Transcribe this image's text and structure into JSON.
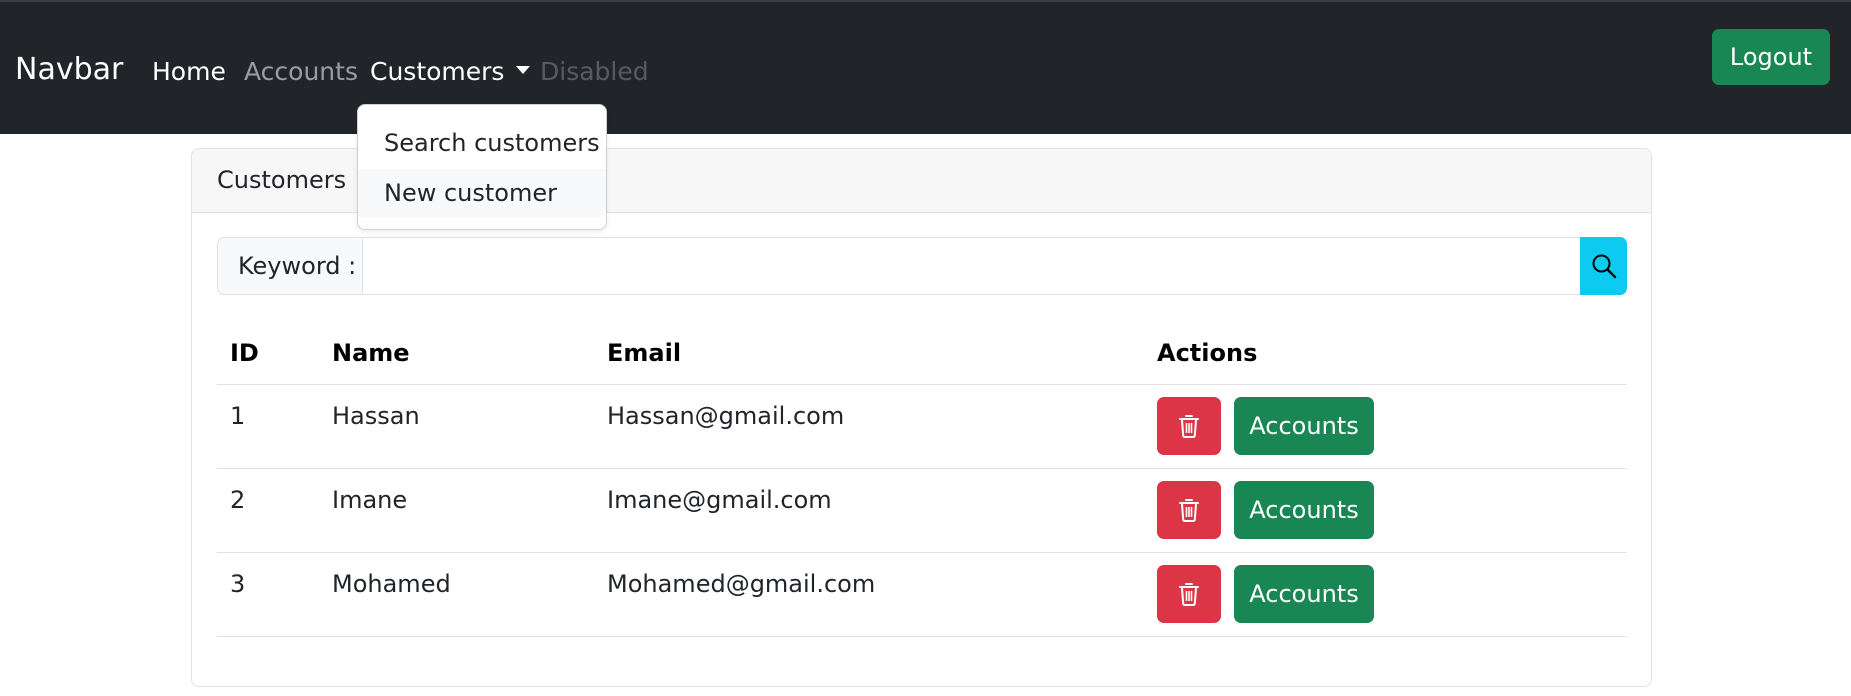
{
  "navbar": {
    "brand": "Navbar",
    "links": {
      "home": "Home",
      "accounts": "Accounts",
      "customers": "Customers",
      "disabled": "Disabled"
    },
    "logout": "Logout"
  },
  "dropdown": {
    "items": [
      "Search customers",
      "New customer"
    ]
  },
  "card": {
    "header": "Customers",
    "search": {
      "label": "Keyword :",
      "value": "",
      "button_icon": "search-icon"
    },
    "table": {
      "columns": [
        "ID",
        "Name",
        "Email",
        "Actions"
      ],
      "rows": [
        {
          "id": "1",
          "name": "Hassan",
          "email": "Hassan@gmail.com",
          "action_label": "Accounts"
        },
        {
          "id": "2",
          "name": "Imane",
          "email": "Imane@gmail.com",
          "action_label": "Accounts"
        },
        {
          "id": "3",
          "name": "Mohamed",
          "email": "Mohamed@gmail.com",
          "action_label": "Accounts"
        }
      ],
      "delete_icon": "trash-icon"
    }
  },
  "colors": {
    "navbar_bg": "#212529",
    "success": "#198754",
    "danger": "#dc3545",
    "info": "#0dcaf0"
  }
}
